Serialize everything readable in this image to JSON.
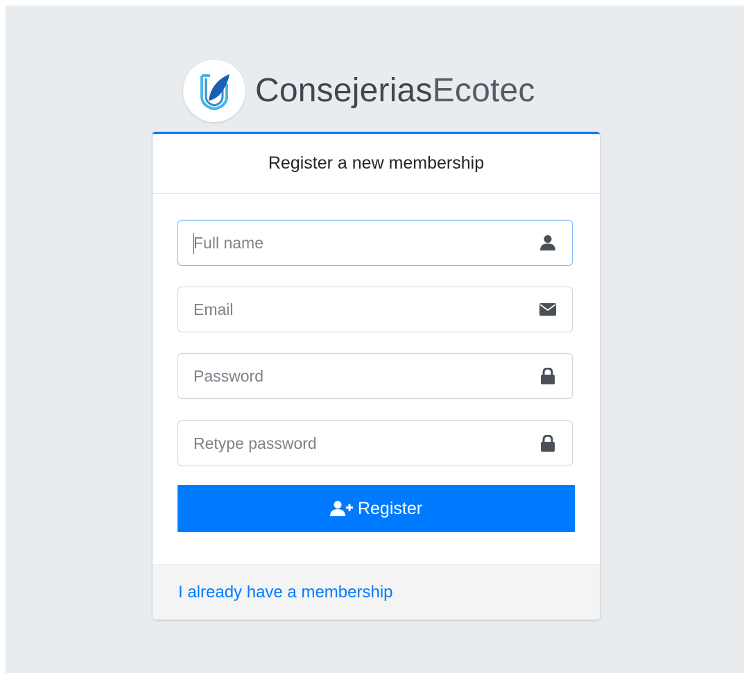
{
  "brand": {
    "name_bold": "Consejerias",
    "name_light": "Ecotec",
    "logo_icon": "ecotec-shield-logo"
  },
  "card": {
    "title": "Register a new membership"
  },
  "form": {
    "full_name": {
      "value": "",
      "placeholder": "Full name",
      "icon": "user-icon"
    },
    "email": {
      "value": "",
      "placeholder": "Email",
      "icon": "envelope-icon"
    },
    "password": {
      "value": "",
      "placeholder": "Password",
      "icon": "lock-icon"
    },
    "retype_password": {
      "value": "",
      "placeholder": "Retype password",
      "icon": "lock-icon"
    },
    "register_label": "Register",
    "register_icon": "user-plus-icon"
  },
  "footer": {
    "login_link": "I already have a membership"
  },
  "colors": {
    "primary": "#007bff",
    "background": "#e9ecef",
    "logo_blue": "#1a73c8",
    "logo_light": "#46b7e3"
  }
}
